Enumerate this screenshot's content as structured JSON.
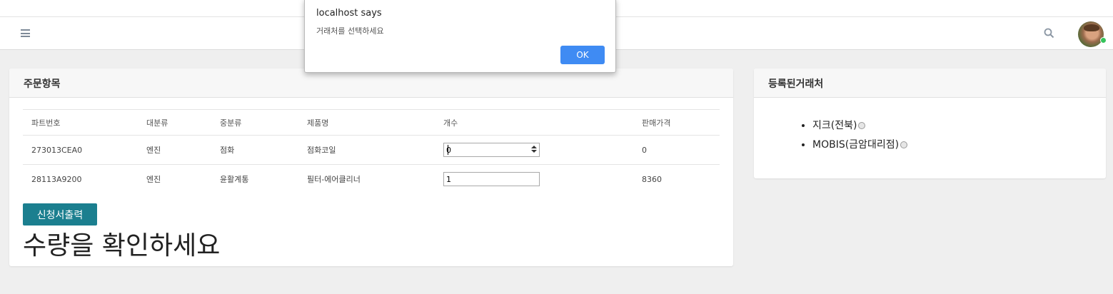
{
  "dialog": {
    "title": "localhost says",
    "message": "거래처를 선택하세요",
    "ok_label": "OK"
  },
  "navbar": {
    "menu_icon": "hamburger-icon",
    "search_icon": "search-icon",
    "user_status_color": "#35c35b"
  },
  "order_panel": {
    "title": "주문항목",
    "columns": [
      "파트번호",
      "대분류",
      "중분류",
      "제품명",
      "개수",
      "판매가격"
    ],
    "rows": [
      {
        "part_no": "273013CEA0",
        "major": "엔진",
        "minor": "점화",
        "product": "점화코일",
        "qty": "0",
        "price": "0"
      },
      {
        "part_no": "28113A9200",
        "major": "엔진",
        "minor": "윤활계통",
        "product": "필터-에어클리너",
        "qty": "1",
        "price": "8360"
      }
    ],
    "print_button": "신청서출력",
    "warning": "수량을 확인하세요"
  },
  "vendor_panel": {
    "title": "등록된거래처",
    "vendors": [
      "지크(전북)",
      "MOBIS(금암대리점)"
    ]
  },
  "colors": {
    "print_button": "#1b7f8f",
    "ok_button": "#3f8bf3"
  }
}
